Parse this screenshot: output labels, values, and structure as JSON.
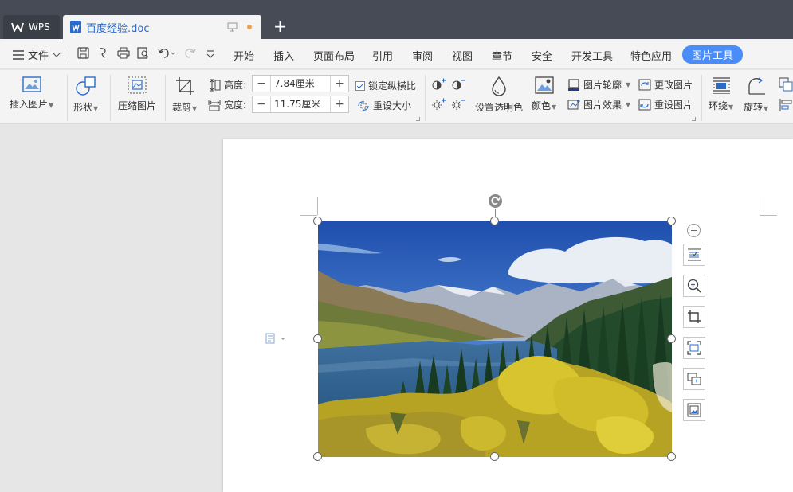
{
  "titlebar": {
    "wps_label": "WPS",
    "doc_title": "百度经验.doc",
    "new_tab": "+"
  },
  "menubar": {
    "file_label": "文件",
    "tabs": [
      "开始",
      "插入",
      "页面布局",
      "引用",
      "审阅",
      "视图",
      "章节",
      "安全",
      "开发工具",
      "特色应用",
      "图片工具"
    ],
    "active_tab": "图片工具"
  },
  "ribbon": {
    "insert_picture": "插入图片",
    "shape": "形状",
    "compress": "压缩图片",
    "crop": "裁剪",
    "height_label": "高度:",
    "height_value": "7.84厘米",
    "width_label": "宽度:",
    "width_value": "11.75厘米",
    "lock_ratio": "锁定纵横比",
    "reset_size": "重设大小",
    "set_transparent": "设置透明色",
    "color": "颜色",
    "picture_outline": "图片轮廓",
    "picture_effect": "图片效果",
    "change_picture": "更改图片",
    "reset_picture": "重设图片",
    "wrap": "环绕",
    "rotate": "旋转"
  },
  "colors": {
    "titlebar": "#474b55",
    "accent": "#4b8df8",
    "doc_title": "#2b6bc8"
  }
}
